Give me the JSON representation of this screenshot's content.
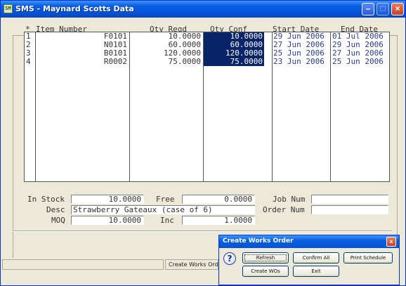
{
  "window": {
    "title": "SMS - Maynard Scotts Data",
    "icon": "app-icon"
  },
  "grid": {
    "headers": {
      "row": "*",
      "item": "Item Number",
      "qty_reqd": "Qty Reqd",
      "qty_conf": "Qty Conf",
      "start": "Start Date",
      "end": "End Date"
    },
    "rows": [
      {
        "n": "1",
        "item": "F0101",
        "qty_reqd": "10.0000",
        "qty_conf": "10.0000",
        "start": "29 Jun 2006",
        "end": "01 Jul 2006"
      },
      {
        "n": "2",
        "item": "N0101",
        "qty_reqd": "60.0000",
        "qty_conf": "60.0000",
        "start": "27 Jun 2006",
        "end": "29 Jun 2006"
      },
      {
        "n": "3",
        "item": "B0101",
        "qty_reqd": "120.0000",
        "qty_conf": "120.0000",
        "start": "25 Jun 2006",
        "end": "27 Jun 2006"
      },
      {
        "n": "4",
        "item": "R0002",
        "qty_reqd": "75.0000",
        "qty_conf": "75.0000",
        "start": "23 Jun 2006",
        "end": "25 Jun 2006"
      }
    ]
  },
  "fields": {
    "in_stock_label": "In Stock",
    "in_stock": "10.0000",
    "free_label": "Free",
    "free": "0.0000",
    "job_num_label": "Job Num",
    "job_num": "",
    "desc_label": "Desc",
    "desc": "Strawberry Gateaux (case of 6)",
    "order_num_label": "Order Num",
    "order_num": "",
    "moq_label": "MOQ",
    "moq": "10.0000",
    "inc_label": "Inc",
    "inc": "1.0000"
  },
  "status_bar": {
    "panel_text": "Create Works Order"
  },
  "dialog": {
    "title": "Create Works Order",
    "buttons": {
      "refresh": "Refresh",
      "confirm_all": "Confirm All",
      "print_schedule": "Print Schedule",
      "create_wos": "Create WOs",
      "exit": "Exit"
    }
  },
  "colors": {
    "selection": "#0a246a",
    "date_text": "#2a3a9a",
    "titlebar": "#0554d9"
  }
}
